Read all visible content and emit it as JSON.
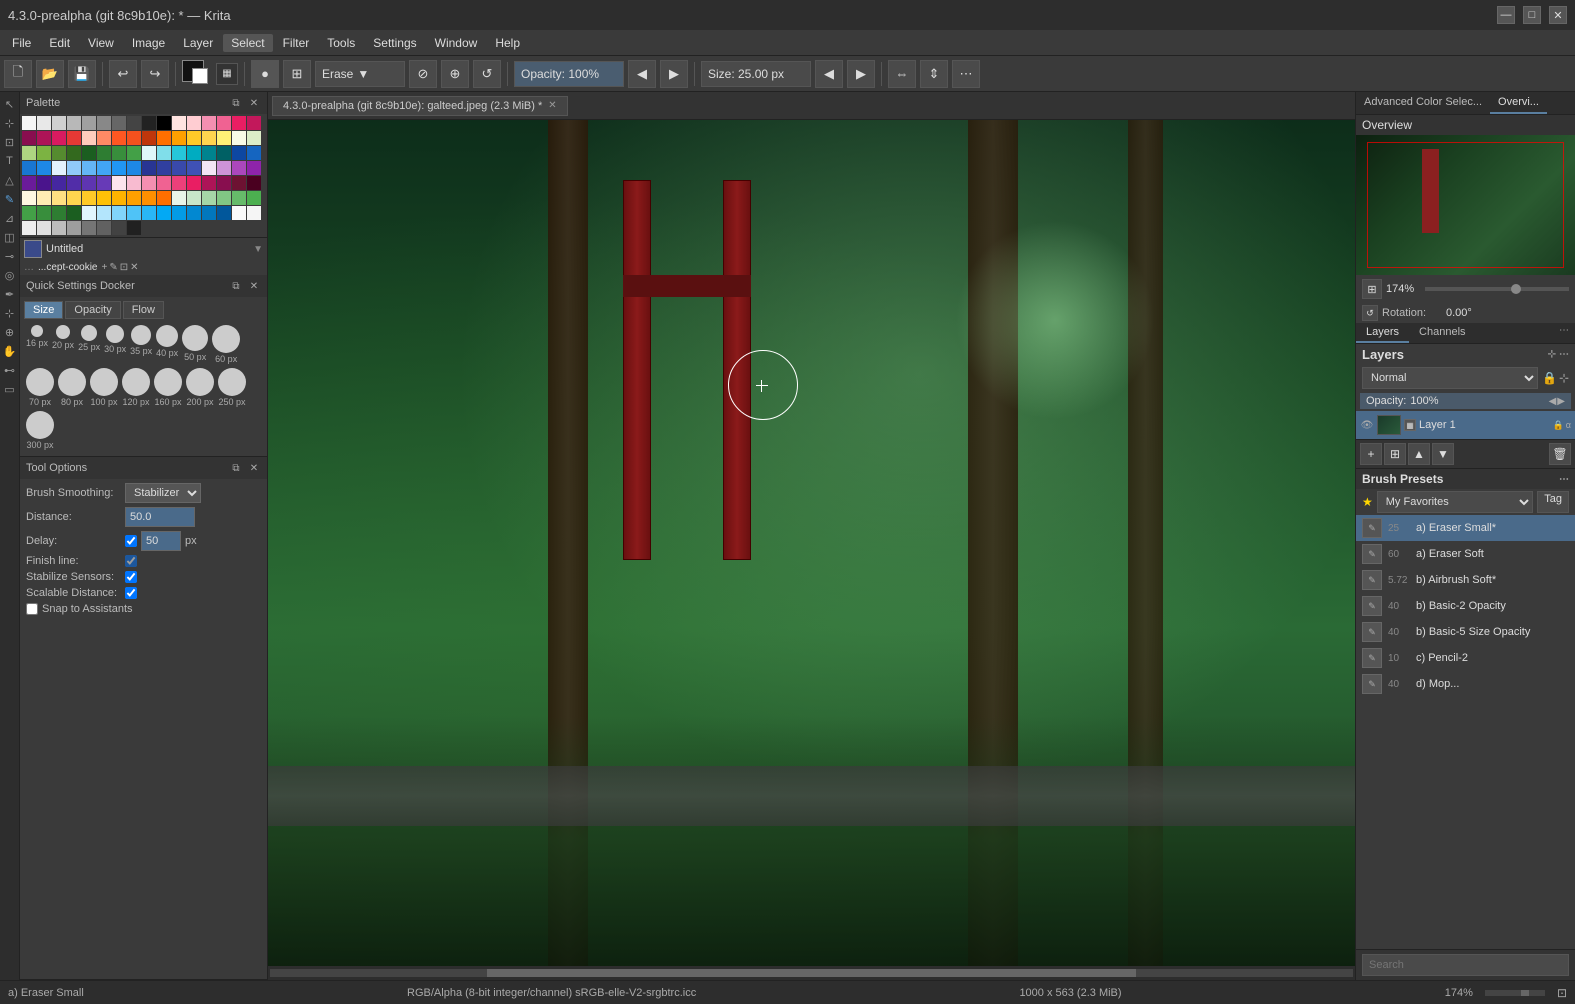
{
  "titlebar": {
    "title": "4.3.0-prealpha (git 8c9b10e): * — Krita",
    "min": "—",
    "max": "□",
    "close": "✕"
  },
  "menu": {
    "items": [
      "File",
      "Edit",
      "View",
      "Image",
      "Layer",
      "Select",
      "Filter",
      "Tools",
      "Settings",
      "Window",
      "Help"
    ]
  },
  "toolbar": {
    "erase_label": "Erase",
    "opacity_label": "Opacity: 100%",
    "size_label": "Size: 25.00 px"
  },
  "left_panel": {
    "palette_title": "Palette",
    "color_name": "Untitled",
    "resource_name": "...cept-cookie",
    "quick_settings_title": "Quick Settings Docker",
    "tabs": [
      "Size",
      "Opacity",
      "Flow"
    ],
    "brush_sizes": [
      {
        "size": 16,
        "label": "16 px"
      },
      {
        "size": 20,
        "label": "20 px"
      },
      {
        "size": 25,
        "label": "25 px"
      },
      {
        "size": 30,
        "label": "30 px"
      },
      {
        "size": 35,
        "label": "35 px"
      },
      {
        "size": 40,
        "label": "40 px"
      },
      {
        "size": 50,
        "label": "50 px"
      },
      {
        "size": 60,
        "label": "60 px"
      },
      {
        "size": 70,
        "label": "70 px"
      },
      {
        "size": 80,
        "label": "80 px"
      },
      {
        "size": 100,
        "label": "100 px"
      },
      {
        "size": 120,
        "label": "120 px"
      },
      {
        "size": 160,
        "label": "160 px"
      },
      {
        "size": 200,
        "label": "200 px"
      },
      {
        "size": 250,
        "label": "250 px"
      },
      {
        "size": 300,
        "label": "300 px"
      }
    ],
    "tool_options_title": "Tool Options",
    "brush_smoothing_label": "Brush Smoothing:",
    "brush_smoothing_value": "Stabilizer",
    "distance_label": "Distance:",
    "distance_value": "50.0",
    "delay_label": "Delay:",
    "delay_value": "50",
    "delay_unit": "px",
    "finish_line_label": "Finish line:",
    "stabilize_sensors_label": "Stabilize Sensors:",
    "scalable_distance_label": "Scalable Distance:",
    "snap_label": "Snap to Assistants"
  },
  "canvas": {
    "tab_title": "4.3.0-prealpha (git 8c9b10e): galteed.jpeg (2.3 MiB) *"
  },
  "right_panel": {
    "tabs": [
      "Advanced Color Selec...",
      "Overvi..."
    ],
    "overview_title": "Overview",
    "zoom_value": "174%",
    "rotation_label": "Rotation:",
    "rotation_value": "0.00°",
    "layers_tab": "Layers",
    "channels_tab": "Channels",
    "layers_title": "Layers",
    "blend_mode": "Normal",
    "opacity_label": "Opacity:",
    "opacity_value": "100%",
    "layer_name": "Layer 1",
    "brush_presets_title": "Brush Presets",
    "favorites_label": "My Favorites",
    "tag_label": "Tag",
    "brushes": [
      {
        "size": "25",
        "name": "a) Eraser Small*",
        "active": true
      },
      {
        "size": "60",
        "name": "a) Eraser Soft",
        "active": false
      },
      {
        "size": "5.72",
        "name": "b) Airbrush Soft*",
        "active": false
      },
      {
        "size": "40",
        "name": "b) Basic-2 Opacity",
        "active": false
      },
      {
        "size": "40",
        "name": "b) Basic-5 Size Opacity",
        "active": false
      },
      {
        "size": "10",
        "name": "c) Pencil-2",
        "active": false
      },
      {
        "size": "40",
        "name": "d) Mop...",
        "active": false
      }
    ],
    "search_placeholder": "Search",
    "search_zoom": "174%"
  },
  "status_bar": {
    "brush_name": "a) Eraser Small",
    "color_info": "RGB/Alpha (8-bit integer/channel)  sRGB-elle-V2-srgbtrc.icc",
    "dimensions": "1000 x 563 (2.3 MiB)",
    "zoom": "174%"
  },
  "swatches": {
    "colors": [
      "#f5f5f5",
      "#e8e8e8",
      "#d0d0d0",
      "#b8b8b8",
      "#a0a0a0",
      "#888",
      "#666",
      "#444",
      "#222",
      "#000",
      "#ffe4e1",
      "#ffcdd2",
      "#f48fb1",
      "#f06292",
      "#e91e63",
      "#c2185b",
      "#880e4f",
      "#ad1457",
      "#d81b60",
      "#e53935",
      "#ffccbc",
      "#ff8a65",
      "#ff5722",
      "#f4511e",
      "#bf360c",
      "#ff6f00",
      "#ffa000",
      "#ffca28",
      "#ffd54f",
      "#fff176",
      "#f9fbe7",
      "#dcedc8",
      "#aed581",
      "#7cb342",
      "#558b2f",
      "#33691e",
      "#1b5e20",
      "#2e7d32",
      "#388e3c",
      "#43a047",
      "#e0f7fa",
      "#80deea",
      "#26c6da",
      "#00acc1",
      "#00838f",
      "#006064",
      "#0d47a1",
      "#1565c0",
      "#1976d2",
      "#1e88e5",
      "#e3f2fd",
      "#90caf9",
      "#64b5f6",
      "#42a5f5",
      "#2196f3",
      "#1e88e5",
      "#283593",
      "#303f9f",
      "#3949ab",
      "#3f51b5",
      "#f3e5f5",
      "#ce93d8",
      "#ab47bc",
      "#8e24aa",
      "#6a1b9a",
      "#4a148c",
      "#4527a0",
      "#512da8",
      "#5e35b1",
      "#673ab7",
      "#fce4ec",
      "#f8bbd0",
      "#f48fb1",
      "#f06292",
      "#ec407a",
      "#e91e63",
      "#ad1457",
      "#880e4f",
      "#6d1232",
      "#4a0020",
      "#fff8e1",
      "#ffecb3",
      "#ffe082",
      "#ffd54f",
      "#ffca28",
      "#ffc107",
      "#ffb300",
      "#ffa000",
      "#ff8f00",
      "#ff6f00",
      "#e8f5e9",
      "#c8e6c9",
      "#a5d6a7",
      "#81c784",
      "#66bb6a",
      "#4caf50",
      "#43a047",
      "#388e3c",
      "#2e7d32",
      "#1b5e20",
      "#e1f5fe",
      "#b3e5fc",
      "#81d4fa",
      "#4fc3f7",
      "#29b6f6",
      "#03a9f4",
      "#039be5",
      "#0288d1",
      "#0277bd",
      "#01579b",
      "#fafafa",
      "#f5f5f5",
      "#eeeeee",
      "#e0e0e0",
      "#bdbdbd",
      "#9e9e9e",
      "#757575",
      "#616161",
      "#424242",
      "#212121"
    ]
  }
}
